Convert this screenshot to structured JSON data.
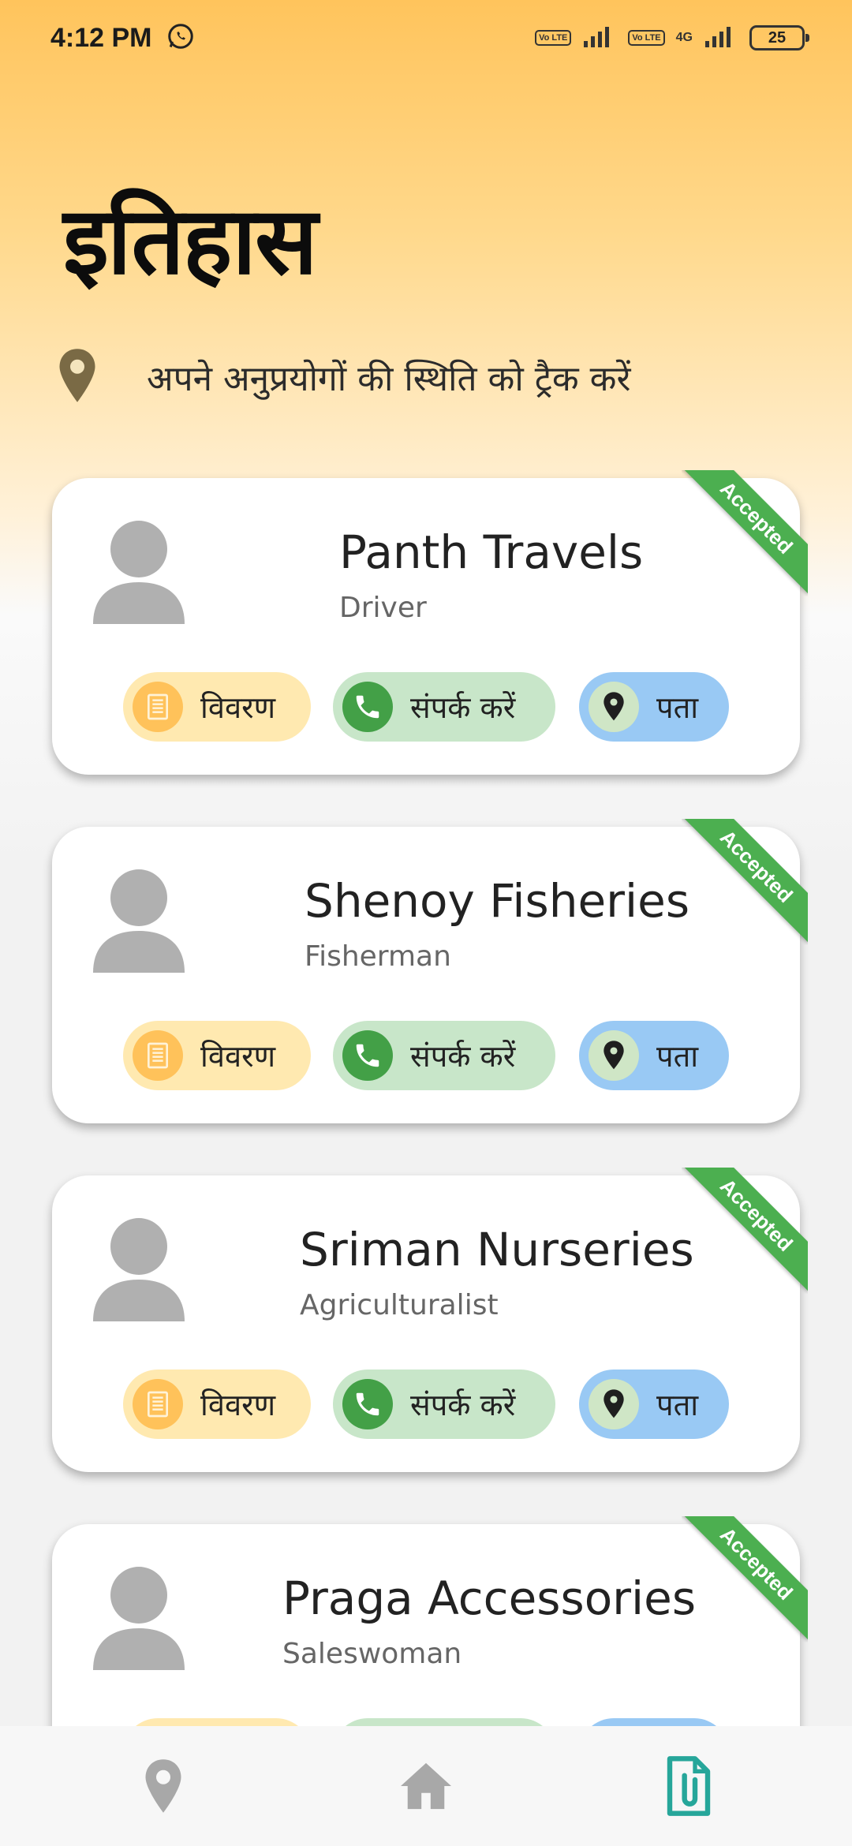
{
  "status": {
    "time": "4:12 PM",
    "volte1": "Vo LTE",
    "volte2": "Vo LTE",
    "network": "4G",
    "battery": "25"
  },
  "header": {
    "title": "इतिहास",
    "subtitle": "अपने अनुप्रयोगों की स्थिति को ट्रैक करें"
  },
  "buttons": {
    "details": "विवरण",
    "contact": "संपर्क करें",
    "address": "पता"
  },
  "cards": [
    {
      "name": "Panth Travels",
      "role": "Driver",
      "status": "Accepted"
    },
    {
      "name": "Shenoy Fisheries",
      "role": "Fisherman",
      "status": "Accepted"
    },
    {
      "name": "Sriman Nurseries",
      "role": "Agriculturalist",
      "status": "Accepted"
    },
    {
      "name": "Praga Accessories",
      "role": "Saleswoman",
      "status": "Accepted"
    }
  ],
  "colors": {
    "accepted": "#4caf50",
    "details_bg": "#ffe9b0",
    "contact_bg": "#c8e6c9",
    "address_bg": "#99c9f4",
    "active_nav": "#26a69a"
  },
  "nav": {
    "icons": [
      "location-pin-icon",
      "home-icon",
      "document-clip-icon"
    ],
    "active": "document-clip-icon"
  }
}
